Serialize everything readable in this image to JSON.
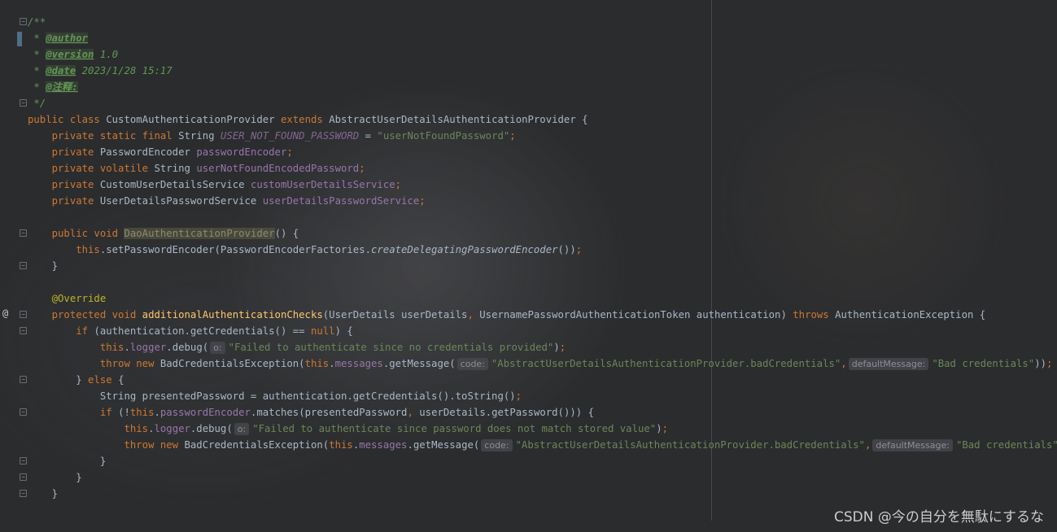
{
  "editor": {
    "language": "java",
    "gutter_marker": "@",
    "lines": [
      {
        "parts": [
          {
            "t": "/**",
            "c": "doc"
          }
        ]
      },
      {
        "parts": [
          {
            "t": " * ",
            "c": "doc"
          },
          {
            "t": "@author",
            "c": "doctag"
          }
        ]
      },
      {
        "parts": [
          {
            "t": " * ",
            "c": "doc"
          },
          {
            "t": "@version",
            "c": "doctag"
          },
          {
            "t": " 1.0",
            "c": "doc"
          }
        ]
      },
      {
        "parts": [
          {
            "t": " * ",
            "c": "doc"
          },
          {
            "t": "@date",
            "c": "doctag"
          },
          {
            "t": " 2023/1/28 15:17",
            "c": "doc"
          }
        ]
      },
      {
        "parts": [
          {
            "t": " * ",
            "c": "doc"
          },
          {
            "t": "@注释:",
            "c": "doctag"
          }
        ]
      },
      {
        "parts": [
          {
            "t": " */",
            "c": "doc"
          }
        ]
      },
      {
        "parts": [
          {
            "t": "public class ",
            "c": "kw"
          },
          {
            "t": "CustomAuthenticationProvider ",
            "c": "cls"
          },
          {
            "t": "extends ",
            "c": "kw"
          },
          {
            "t": "AbstractUserDetailsAuthenticationProvider {",
            "c": "cls"
          }
        ]
      },
      {
        "parts": [
          {
            "t": "    private static final ",
            "c": "kw"
          },
          {
            "t": "String ",
            "c": "cls"
          },
          {
            "t": "USER_NOT_FOUND_PASSWORD",
            "c": "const"
          },
          {
            "t": " = ",
            "c": "cls"
          },
          {
            "t": "\"userNotFoundPassword\"",
            "c": "str"
          },
          {
            "t": ";",
            "c": "kw"
          }
        ]
      },
      {
        "parts": [
          {
            "t": "    private ",
            "c": "kw"
          },
          {
            "t": "PasswordEncoder ",
            "c": "cls"
          },
          {
            "t": "passwordEncoder",
            "c": "field"
          },
          {
            "t": ";",
            "c": "kw"
          }
        ]
      },
      {
        "parts": [
          {
            "t": "    private volatile ",
            "c": "kw"
          },
          {
            "t": "String ",
            "c": "cls"
          },
          {
            "t": "userNotFoundEncodedPassword",
            "c": "field"
          },
          {
            "t": ";",
            "c": "kw"
          }
        ]
      },
      {
        "parts": [
          {
            "t": "    private ",
            "c": "kw"
          },
          {
            "t": "CustomUserDetailsService ",
            "c": "cls"
          },
          {
            "t": "customUserDetailsService",
            "c": "field"
          },
          {
            "t": ";",
            "c": "kw"
          }
        ]
      },
      {
        "parts": [
          {
            "t": "    private ",
            "c": "kw"
          },
          {
            "t": "UserDetailsPasswordService ",
            "c": "cls"
          },
          {
            "t": "userDetailsPasswordService",
            "c": "field"
          },
          {
            "t": ";",
            "c": "kw"
          }
        ]
      },
      {
        "parts": []
      },
      {
        "parts": [
          {
            "t": "    public void ",
            "c": "kw"
          },
          {
            "t": "DaoAuthenticationProvider",
            "c": "unused"
          },
          {
            "t": "() {",
            "c": "cls"
          }
        ]
      },
      {
        "parts": [
          {
            "t": "        this",
            "c": "kw"
          },
          {
            "t": ".setPasswordEncoder(PasswordEncoderFactories.",
            "c": "cls"
          },
          {
            "t": "createDelegatingPasswordEncoder",
            "c": "smethod"
          },
          {
            "t": "())",
            "c": "cls"
          },
          {
            "t": ";",
            "c": "kw"
          }
        ]
      },
      {
        "parts": [
          {
            "t": "    }",
            "c": "cls"
          }
        ]
      },
      {
        "parts": []
      },
      {
        "parts": [
          {
            "t": "    @Override",
            "c": "ann"
          }
        ]
      },
      {
        "parts": [
          {
            "t": "    protected void ",
            "c": "kw"
          },
          {
            "t": "additionalAuthenticationChecks",
            "c": "method"
          },
          {
            "t": "(UserDetails userDetails",
            "c": "cls"
          },
          {
            "t": ", ",
            "c": "kw"
          },
          {
            "t": "UsernamePasswordAuthenticationToken authentication) ",
            "c": "cls"
          },
          {
            "t": "throws ",
            "c": "kw"
          },
          {
            "t": "AuthenticationException {",
            "c": "cls"
          }
        ]
      },
      {
        "parts": [
          {
            "t": "        if ",
            "c": "kw"
          },
          {
            "t": "(authentication.getCredentials() == ",
            "c": "cls"
          },
          {
            "t": "null",
            "c": "kw"
          },
          {
            "t": ") {",
            "c": "cls"
          }
        ]
      },
      {
        "parts": [
          {
            "t": "            this",
            "c": "kw"
          },
          {
            "t": ".",
            "c": "cls"
          },
          {
            "t": "logger",
            "c": "field"
          },
          {
            "t": ".debug(",
            "c": "cls"
          },
          {
            "t": "o:",
            "c": "hint"
          },
          {
            "t": "\"Failed to authenticate since no credentials provided\"",
            "c": "str"
          },
          {
            "t": ")",
            "c": "cls"
          },
          {
            "t": ";",
            "c": "kw"
          }
        ]
      },
      {
        "parts": [
          {
            "t": "            throw new ",
            "c": "kw"
          },
          {
            "t": "BadCredentialsException(",
            "c": "cls"
          },
          {
            "t": "this",
            "c": "kw"
          },
          {
            "t": ".",
            "c": "cls"
          },
          {
            "t": "messages",
            "c": "field"
          },
          {
            "t": ".getMessage(",
            "c": "cls"
          },
          {
            "t": "code:",
            "c": "hint"
          },
          {
            "t": "\"AbstractUserDetailsAuthenticationProvider.badCredentials\"",
            "c": "str"
          },
          {
            "t": ",",
            "c": "kw"
          },
          {
            "t": "defaultMessage:",
            "c": "hint"
          },
          {
            "t": "\"Bad credentials\"",
            "c": "str"
          },
          {
            "t": "))",
            "c": "cls"
          },
          {
            "t": ";",
            "c": "kw"
          }
        ]
      },
      {
        "parts": [
          {
            "t": "        } ",
            "c": "cls"
          },
          {
            "t": "else ",
            "c": "kw"
          },
          {
            "t": "{",
            "c": "cls"
          }
        ]
      },
      {
        "parts": [
          {
            "t": "            String presentedPassword = authentication.getCredentials().toString()",
            "c": "cls"
          },
          {
            "t": ";",
            "c": "kw"
          }
        ]
      },
      {
        "parts": [
          {
            "t": "            if ",
            "c": "kw"
          },
          {
            "t": "(!",
            "c": "cls"
          },
          {
            "t": "this",
            "c": "kw"
          },
          {
            "t": ".",
            "c": "cls"
          },
          {
            "t": "passwordEncoder",
            "c": "field"
          },
          {
            "t": ".matches(presentedPassword",
            "c": "cls"
          },
          {
            "t": ", ",
            "c": "kw"
          },
          {
            "t": "userDetails.getPassword())) {",
            "c": "cls"
          }
        ]
      },
      {
        "parts": [
          {
            "t": "                this",
            "c": "kw"
          },
          {
            "t": ".",
            "c": "cls"
          },
          {
            "t": "logger",
            "c": "field"
          },
          {
            "t": ".debug(",
            "c": "cls"
          },
          {
            "t": "o:",
            "c": "hint"
          },
          {
            "t": "\"Failed to authenticate since password does not match stored value\"",
            "c": "str"
          },
          {
            "t": ")",
            "c": "cls"
          },
          {
            "t": ";",
            "c": "kw"
          }
        ]
      },
      {
        "parts": [
          {
            "t": "                throw new ",
            "c": "kw"
          },
          {
            "t": "BadCredentialsException(",
            "c": "cls"
          },
          {
            "t": "this",
            "c": "kw"
          },
          {
            "t": ".",
            "c": "cls"
          },
          {
            "t": "messages",
            "c": "field"
          },
          {
            "t": ".getMessage(",
            "c": "cls"
          },
          {
            "t": "code:",
            "c": "hint"
          },
          {
            "t": "\"AbstractUserDetailsAuthenticationProvider.badCredentials\"",
            "c": "str"
          },
          {
            "t": ",",
            "c": "kw"
          },
          {
            "t": "defaultMessage:",
            "c": "hint"
          },
          {
            "t": "\"Bad credentials\"",
            "c": "str"
          },
          {
            "t": "))",
            "c": "cls"
          },
          {
            "t": ";",
            "c": "kw"
          }
        ]
      },
      {
        "parts": [
          {
            "t": "            }",
            "c": "cls"
          }
        ]
      },
      {
        "parts": [
          {
            "t": "        }",
            "c": "cls"
          }
        ]
      },
      {
        "parts": [
          {
            "t": "    }",
            "c": "cls"
          }
        ]
      }
    ]
  },
  "watermark": "CSDN @今の自分を無駄にするな"
}
